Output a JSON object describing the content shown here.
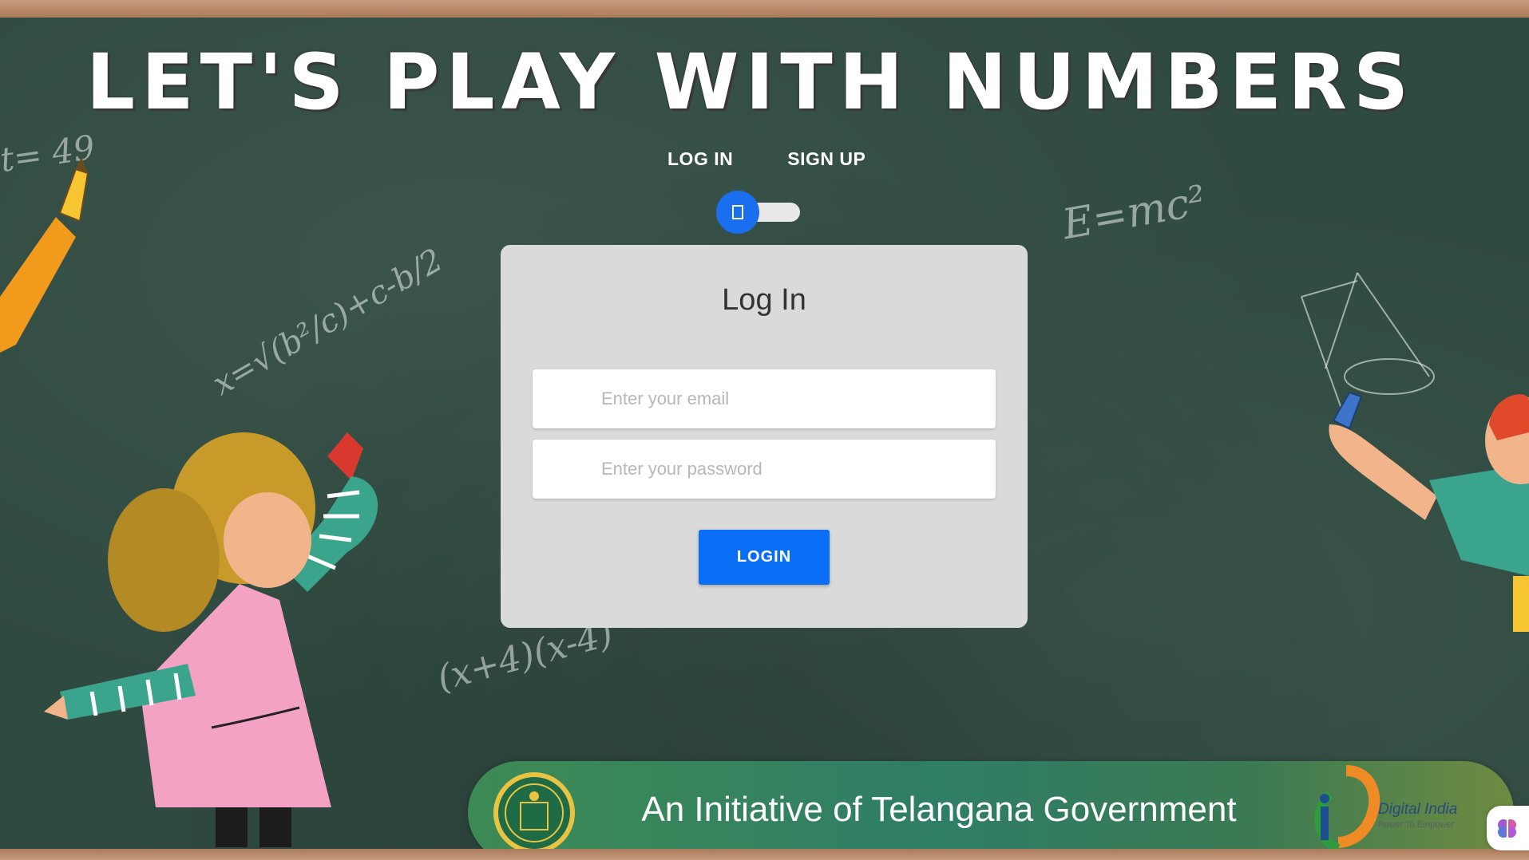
{
  "headline": {
    "title": "LET'S PLAY WITH NUMBERS"
  },
  "auth_tabs": {
    "login_label": "LOG IN",
    "signup_label": "SIGN UP"
  },
  "login_card": {
    "title": "Log In",
    "email": {
      "value": "",
      "placeholder": "Enter your email"
    },
    "password": {
      "value": "",
      "placeholder": "Enter your password"
    },
    "login_button": "LOGIN"
  },
  "footer_banner": {
    "text": "An Initiative of Telangana Government"
  },
  "digital_india": {
    "title": "Digital India",
    "tagline": "Power To Empower"
  },
  "board_writing": {
    "top_left": "t= 49",
    "formula": "x=√(b²/c)+c-b/2",
    "emc2": "E=mc²",
    "factors": "(x+4)(x-4)"
  },
  "theme": {
    "accent": "#0a6ff6",
    "board": "#2f4a40",
    "card": "#dadada",
    "banner_green": "#3e8a55"
  },
  "icons": {
    "toggle": "toggle-switch-icon",
    "emblem": "telangana-emblem-icon",
    "digital_india": "digital-india-logo-icon",
    "assistant": "brain-icon"
  }
}
